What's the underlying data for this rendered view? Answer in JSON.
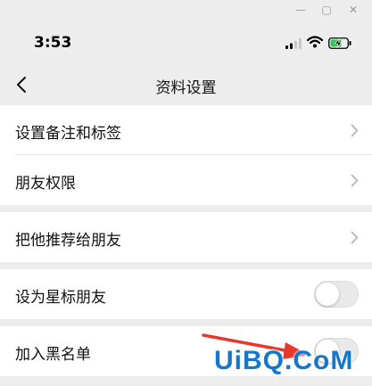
{
  "window": {
    "controls": [
      {
        "icon": "minimize-icon",
        "glyph": "—"
      },
      {
        "icon": "maximize-icon",
        "glyph": "▢"
      },
      {
        "icon": "close-icon",
        "glyph": "✕"
      }
    ]
  },
  "status_bar": {
    "time": "3:53",
    "signal_icon": "cellular-signal-icon",
    "wifi_icon": "wifi-icon",
    "battery_icon": "battery-charging-icon"
  },
  "nav": {
    "back_icon": "chevron-left-icon",
    "title": "资料设置"
  },
  "rows": [
    {
      "label": "设置备注和标签",
      "accessory": "chevron"
    },
    {
      "label": "朋友权限",
      "accessory": "chevron"
    },
    {
      "label": "把他推荐给朋友",
      "accessory": "chevron"
    },
    {
      "label": "设为星标朋友",
      "accessory": "toggle",
      "on": false
    },
    {
      "label": "加入黑名单",
      "accessory": "toggle",
      "on": false
    }
  ],
  "colors": {
    "background": "#ededed",
    "row": "#ffffff",
    "annotation_arrow": "#e8362b",
    "watermark": "#1677c9"
  },
  "watermark": "UiBQ.CoM"
}
